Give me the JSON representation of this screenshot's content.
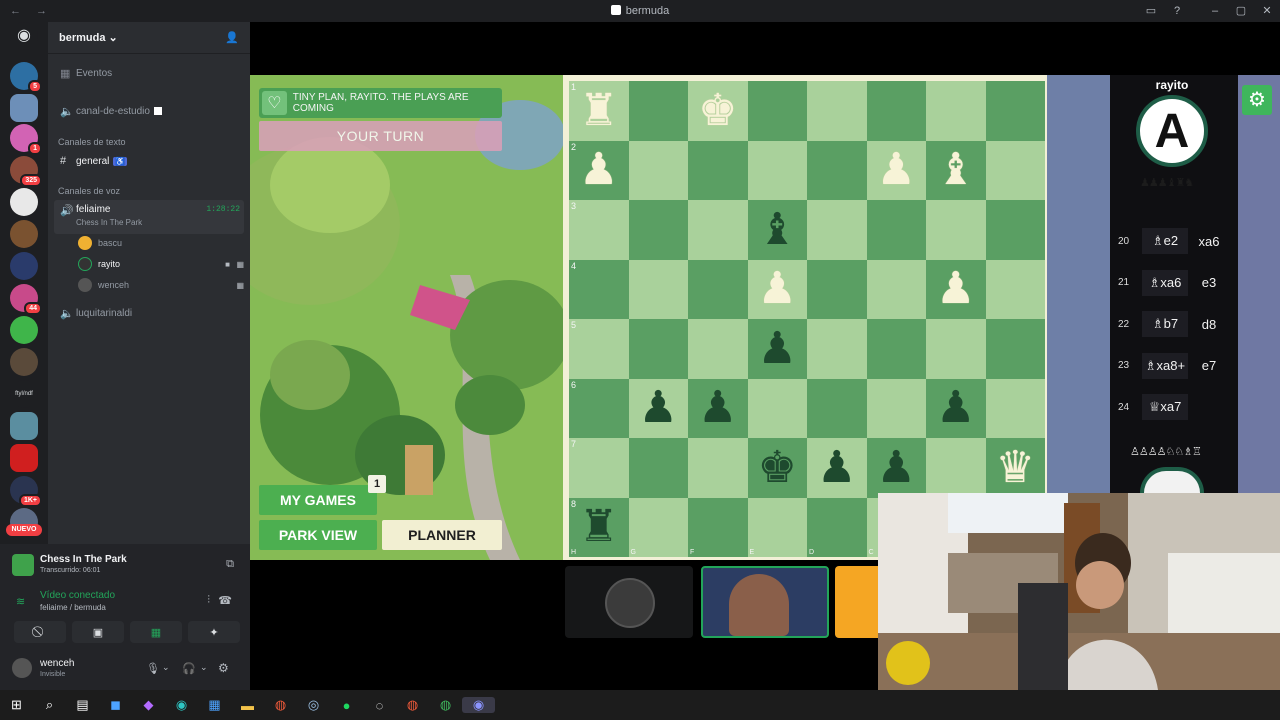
{
  "window": {
    "title": "bermuda",
    "nav": "← →"
  },
  "guilds": {
    "badges": [
      "5",
      "1",
      "325",
      "44",
      "1K+"
    ],
    "new_label": "NUEVO",
    "text_label": "ftyl/ndf"
  },
  "server": {
    "name": "bermuda",
    "events": "Eventos",
    "study_channel": "canal-de-estudio",
    "text_category": "Canales de texto",
    "general": "general",
    "voice_category": "Canales de voz",
    "voice_channel": "feliaime",
    "voice_activity": "Chess In The Park",
    "voice_timer": "1:28:22",
    "voice_users": [
      "bascu",
      "rayito",
      "wenceh"
    ],
    "other_channel": "luquitarinaldi"
  },
  "activity": {
    "title": "Chess In The Park",
    "elapsed": "Transcurrido: 06:01"
  },
  "voice_status": {
    "label": "Vídeo conectado",
    "location": "feliaime / bermuda"
  },
  "user": {
    "name": "wenceh",
    "status": "Invisible"
  },
  "game": {
    "banner": "TINY PLAN, RAYITO. THE PLAYS ARE COMING",
    "turn": "YOUR TURN",
    "my_games": "MY GAMES",
    "my_games_count": "1",
    "park_view": "PARK VIEW",
    "planner": "PLANNER",
    "opponent": "rayito",
    "opponent_initial": "A",
    "ranks": [
      "1",
      "2",
      "3",
      "4",
      "5",
      "6",
      "7",
      "8"
    ],
    "files": [
      "H",
      "G",
      "F",
      "E",
      "D",
      "C",
      "B",
      "A"
    ],
    "board": [
      [
        "wR",
        "",
        "wK",
        "",
        "",
        "",
        "",
        ""
      ],
      [
        "wP",
        "",
        "",
        "",
        "",
        "wP",
        "wB",
        ""
      ],
      [
        "",
        "",
        "",
        "bB",
        "",
        "",
        "",
        ""
      ],
      [
        "",
        "",
        "",
        "wP",
        "",
        "",
        "wP",
        ""
      ],
      [
        "",
        "",
        "",
        "bP",
        "",
        "",
        "",
        ""
      ],
      [
        "",
        "bP",
        "bP",
        "",
        "",
        "",
        "bP",
        ""
      ],
      [
        "",
        "",
        "",
        "bK",
        "bP",
        "bP",
        "",
        "wQ"
      ],
      [
        "bR",
        "",
        "",
        "",
        "",
        "",
        "",
        ""
      ]
    ],
    "moves": [
      {
        "n": "20",
        "w": "♗e2",
        "b": "xa6"
      },
      {
        "n": "21",
        "w": "♗xa6",
        "b": "e3"
      },
      {
        "n": "22",
        "w": "♗b7",
        "b": "d8"
      },
      {
        "n": "23",
        "w": "♗xa8+",
        "b": "e7"
      },
      {
        "n": "24",
        "w": "♕xa7",
        "b": ""
      }
    ],
    "captured_top": "♟♟♟♝♜♞",
    "captured_bottom": "♙♙♙♙♘♘♗♖"
  },
  "colors": {
    "accent_green": "#4a9f54",
    "board_light": "#a9d19b",
    "board_dark": "#5a9f63",
    "discord_bg": "#2b2d31"
  }
}
